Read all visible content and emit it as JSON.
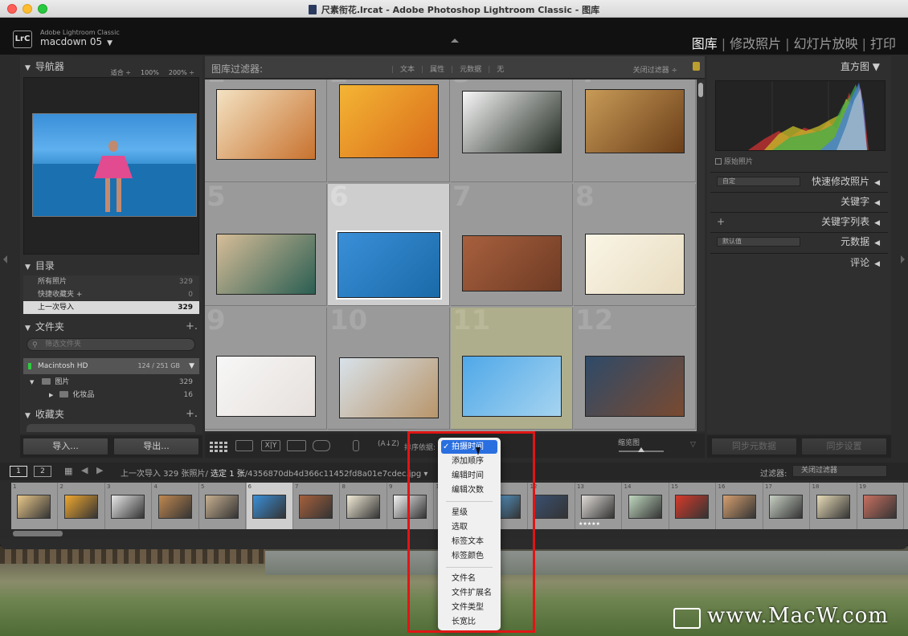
{
  "window": {
    "title": "尺素衔花.lrcat - Adobe Photoshop Lightroom Classic - 图库"
  },
  "identity": {
    "logo": "LrC",
    "app": "Adobe Lightroom Classic",
    "user": "macdown 05"
  },
  "modules": [
    {
      "label": "图库",
      "active": true
    },
    {
      "label": "修改照片"
    },
    {
      "label": "幻灯片放映"
    },
    {
      "label": "打印"
    }
  ],
  "left": {
    "navigator": {
      "title": "导航器",
      "opts": [
        "适合 ÷",
        "100%",
        "200% ÷"
      ]
    },
    "catalog": {
      "title": "目录",
      "items": [
        {
          "label": "所有照片",
          "count": "329"
        },
        {
          "label": "快捷收藏夹 +",
          "count": "0"
        },
        {
          "label": "上一次导入",
          "count": "329",
          "selected": true
        }
      ]
    },
    "folders": {
      "title": "文件夹",
      "plus": "+.",
      "search_placeholder": "筛选文件夹",
      "volume": {
        "name": "Macintosh HD",
        "capacity": "124 / 251 GB",
        "dd": "▼"
      },
      "tree": [
        {
          "tri": "▼",
          "label": "图片",
          "count": "329"
        },
        {
          "tri": "▶",
          "label": "化妆品",
          "count": "16"
        }
      ]
    },
    "collections": {
      "title": "收藏夹",
      "plus": "+."
    },
    "buttons": {
      "import": "导入...",
      "export": "导出..."
    }
  },
  "filterbar": {
    "title": "图库过滤器:",
    "tabs": [
      "文本",
      "属性",
      "元数据",
      "无"
    ],
    "close": "关闭过滤器 ÷"
  },
  "grid": {
    "cells": [
      {
        "num": "1",
        "colors": [
          "#f3e2c2",
          "#c8722e"
        ]
      },
      {
        "num": "2",
        "colors": [
          "#f4b534",
          "#d96b1a"
        ]
      },
      {
        "num": "3",
        "colors": [
          "#f7f7f7",
          "#202820"
        ]
      },
      {
        "num": "4",
        "colors": [
          "#c89b58",
          "#6b3e18"
        ]
      },
      {
        "num": "5",
        "colors": [
          "#d7bd98",
          "#2a5e52"
        ]
      },
      {
        "num": "6",
        "colors": [
          "#3a8fd8",
          "#1a6aa8"
        ],
        "selected": true
      },
      {
        "num": "7",
        "colors": [
          "#a8603e",
          "#6e3b24"
        ]
      },
      {
        "num": "8",
        "colors": [
          "#faf5e6",
          "#e8dcc0"
        ]
      },
      {
        "num": "9",
        "colors": [
          "#f7f7f7",
          "#e6e0dc"
        ]
      },
      {
        "num": "10",
        "colors": [
          "#d8e2ea",
          "#b8956a"
        ]
      },
      {
        "num": "11",
        "colors": [
          "#4fa8e8",
          "#a6d4f0"
        ],
        "tagged": true,
        "stars": "★★★★★"
      },
      {
        "num": "12",
        "colors": [
          "#2e4a68",
          "#7a4a30"
        ]
      }
    ]
  },
  "toolbar": {
    "sort": "排序依据:",
    "thumb": "缩览图"
  },
  "sort_menu": {
    "items": [
      "拍摄时间",
      "添加顺序",
      "编辑时间",
      "编辑次数",
      "星级",
      "选取",
      "标签文本",
      "标签颜色",
      "文件名",
      "文件扩展名",
      "文件类型",
      "长宽比"
    ],
    "checked": "✓"
  },
  "right": {
    "histogram": {
      "title": "直方图 ▼",
      "original": "原始照片"
    },
    "quick": {
      "preset": "自定",
      "title": "快速修改照片"
    },
    "keywords": "关键字",
    "keywordlist": "关键字列表",
    "metadata": {
      "preset": "默认值",
      "title": "元数据"
    },
    "comments": "评论",
    "buttons": {
      "syncmeta": "同步元数据",
      "syncset": "同步设置"
    }
  },
  "filmstrip": {
    "pages": [
      "1",
      "2"
    ],
    "source": "上一次导入  329 张照片/",
    "selected": "选定 1 张",
    "file": "/4356870db4d366c11452fd8a01e7cdec.jpg ▾",
    "filter_label": "过滤器:",
    "filter_value": "关闭过滤器",
    "cells": [
      {
        "n": "1",
        "c": "#e9c88a"
      },
      {
        "n": "2",
        "c": "#f0a830"
      },
      {
        "n": "3",
        "c": "#e8e8e8"
      },
      {
        "n": "4",
        "c": "#c08850"
      },
      {
        "n": "5",
        "c": "#c8b090"
      },
      {
        "n": "6",
        "c": "#3a8fd8",
        "sel": true
      },
      {
        "n": "7",
        "c": "#a6603c"
      },
      {
        "n": "8",
        "c": "#f3ecd8"
      },
      {
        "n": "9",
        "c": "#f3f3f3"
      },
      {
        "n": "10",
        "c": "#d8e0e6"
      },
      {
        "n": "11",
        "c": "#5aa8e0"
      },
      {
        "n": "12",
        "c": "#3a5070"
      },
      {
        "n": "13",
        "c": "#e0dcd8",
        "st": "★★★★★"
      },
      {
        "n": "14",
        "c": "#c0d8c0"
      },
      {
        "n": "15",
        "c": "#d63a2a"
      },
      {
        "n": "16",
        "c": "#d6a070"
      },
      {
        "n": "17",
        "c": "#c8d0c4"
      },
      {
        "n": "18",
        "c": "#e8dcb8"
      },
      {
        "n": "19",
        "c": "#c87060"
      }
    ]
  },
  "watermark": "www.MacW.com"
}
